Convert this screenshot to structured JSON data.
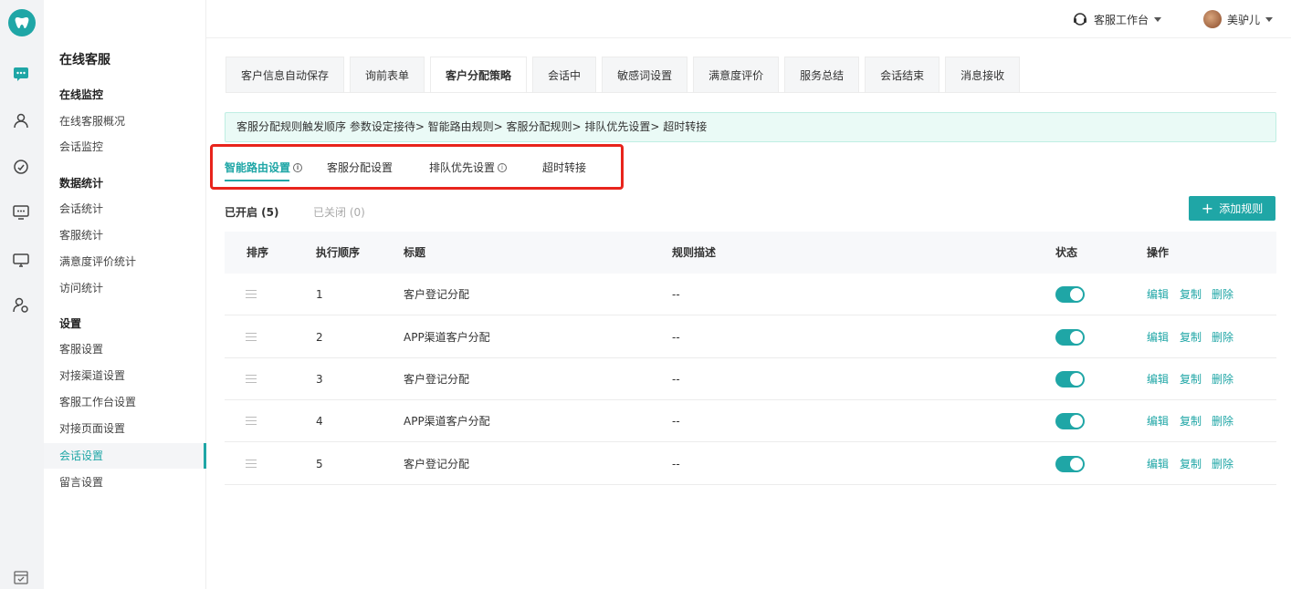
{
  "rail": {
    "icons": [
      "tooth-logo-icon",
      "chat-icon",
      "users-icon",
      "gauge-icon",
      "monitor-chat-icon",
      "screen-icon",
      "user-settings-icon",
      "calendar-check-icon"
    ]
  },
  "sidebar": {
    "title": "在线客服",
    "groups": [
      {
        "label": "在线监控",
        "items": [
          "在线客服概况",
          "会话监控"
        ]
      },
      {
        "label": "数据统计",
        "items": [
          "会话统计",
          "客服统计",
          "满意度评价统计",
          "访问统计"
        ]
      },
      {
        "label": "设置",
        "items": [
          "客服设置",
          "对接渠道设置",
          "客服工作台设置",
          "对接页面设置",
          "会话设置",
          "留言设置"
        ]
      }
    ],
    "active_item": "会话设置"
  },
  "topbar": {
    "workbench_label": "客服工作台",
    "user_name": "美驴儿"
  },
  "tabs": [
    "客户信息自动保存",
    "询前表单",
    "客户分配策略",
    "会话中",
    "敏感词设置",
    "满意度评价",
    "服务总结",
    "会话结束",
    "消息接收"
  ],
  "active_tab": "客户分配策略",
  "notice": "客服分配规则触发顺序 参数设定接待> 智能路由规则> 客服分配规则> 排队优先设置> 超时转接",
  "subtabs": [
    {
      "label": "智能路由设置",
      "info": true
    },
    {
      "label": "客服分配设置",
      "info": false
    },
    {
      "label": "排队优先设置",
      "info": true
    },
    {
      "label": "超时转接",
      "info": false
    }
  ],
  "info_glyph": "i",
  "filters": {
    "enabled": "已开启 (5)",
    "disabled": "已关闭 (0)"
  },
  "add_button": {
    "icon": "plus-icon",
    "plus": "+",
    "label": "添加规则"
  },
  "table": {
    "headers": {
      "sort": "排序",
      "order": "执行顺序",
      "title": "标题",
      "desc": "规则描述",
      "status": "状态",
      "ops": "操作"
    },
    "rows": [
      {
        "order": "1",
        "title": "客户登记分配",
        "desc": "--",
        "enabled": true
      },
      {
        "order": "2",
        "title": "APP渠道客户分配",
        "desc": "--",
        "enabled": true
      },
      {
        "order": "3",
        "title": "客户登记分配",
        "desc": "--",
        "enabled": true
      },
      {
        "order": "4",
        "title": "APP渠道客户分配",
        "desc": "--",
        "enabled": true
      },
      {
        "order": "5",
        "title": "客户登记分配",
        "desc": "--",
        "enabled": true
      }
    ],
    "ops": {
      "edit": "编辑",
      "copy": "复制",
      "delete": "删除"
    }
  },
  "colors": {
    "accent": "#1fa6a6",
    "highlight_box": "#e8241c",
    "notice_bg": "#eafaf6"
  }
}
